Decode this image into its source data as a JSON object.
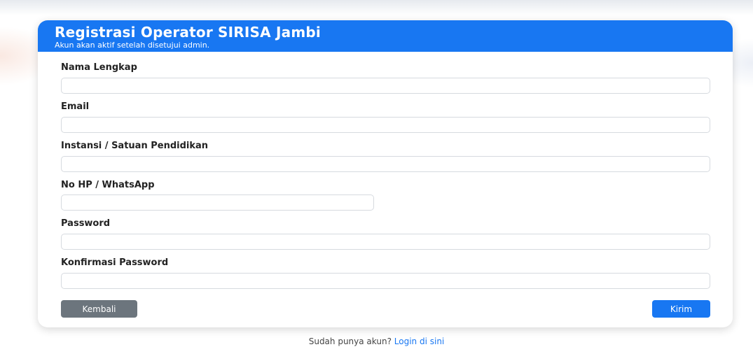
{
  "header": {
    "title": "Registrasi Operator SIRISA Jambi",
    "subtitle": "Akun akan aktif setelah disetujui admin."
  },
  "form": {
    "full_name": {
      "label": "Nama Lengkap",
      "value": ""
    },
    "email": {
      "label": "Email",
      "value": ""
    },
    "institution": {
      "label": "Instansi / Satuan Pendidikan",
      "value": ""
    },
    "phone": {
      "label": "No HP / WhatsApp",
      "value": ""
    },
    "password": {
      "label": "Password",
      "value": ""
    },
    "confirm_password": {
      "label": "Konfirmasi Password",
      "value": ""
    }
  },
  "actions": {
    "back_label": "Kembali",
    "submit_label": "Kirim"
  },
  "footer": {
    "question": "Sudah punya akun?",
    "login_link": "Login di sini"
  },
  "colors": {
    "primary": "#1877f2",
    "secondary": "#6c757d"
  }
}
